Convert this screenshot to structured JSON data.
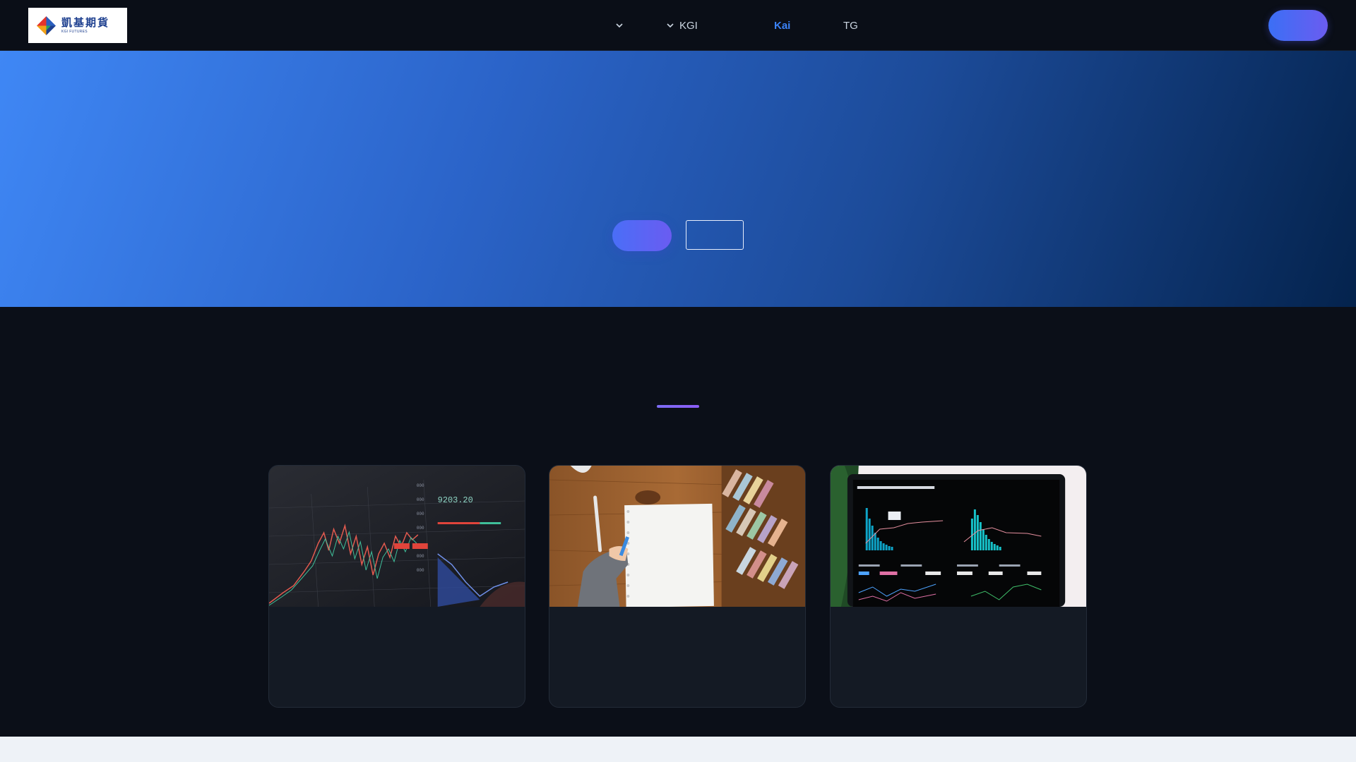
{
  "brand": {
    "name_cn": "凱基期貨",
    "name_en": "KGI FUTURES",
    "logo_icon": "kgi-diamond-logo"
  },
  "nav": {
    "items": [
      {
        "label": "",
        "has_dropdown": true,
        "active": false
      },
      {
        "label": "KGI",
        "has_dropdown": true,
        "active": false
      },
      {
        "label": "Kai",
        "has_dropdown": false,
        "active": true
      },
      {
        "label": "TG",
        "has_dropdown": false,
        "active": false
      }
    ],
    "cta_label": ""
  },
  "hero": {
    "primary_label": "",
    "secondary_label": ""
  },
  "section": {
    "cards": [
      {
        "image": "trading-chart-screen",
        "title": "",
        "text": ""
      },
      {
        "image": "notebook-on-desk",
        "title": "",
        "text": ""
      },
      {
        "image": "analytics-dashboard-laptop",
        "title": "",
        "text": ""
      }
    ]
  },
  "colors": {
    "active_nav": "#3b82f6",
    "accent_gradient_start": "#3b6ff5",
    "accent_gradient_end": "#6b5cf0",
    "hero_start": "#3f87f5",
    "hero_end": "#04234d",
    "page_bg": "#0b0f18",
    "card_bg": "#141a24"
  }
}
